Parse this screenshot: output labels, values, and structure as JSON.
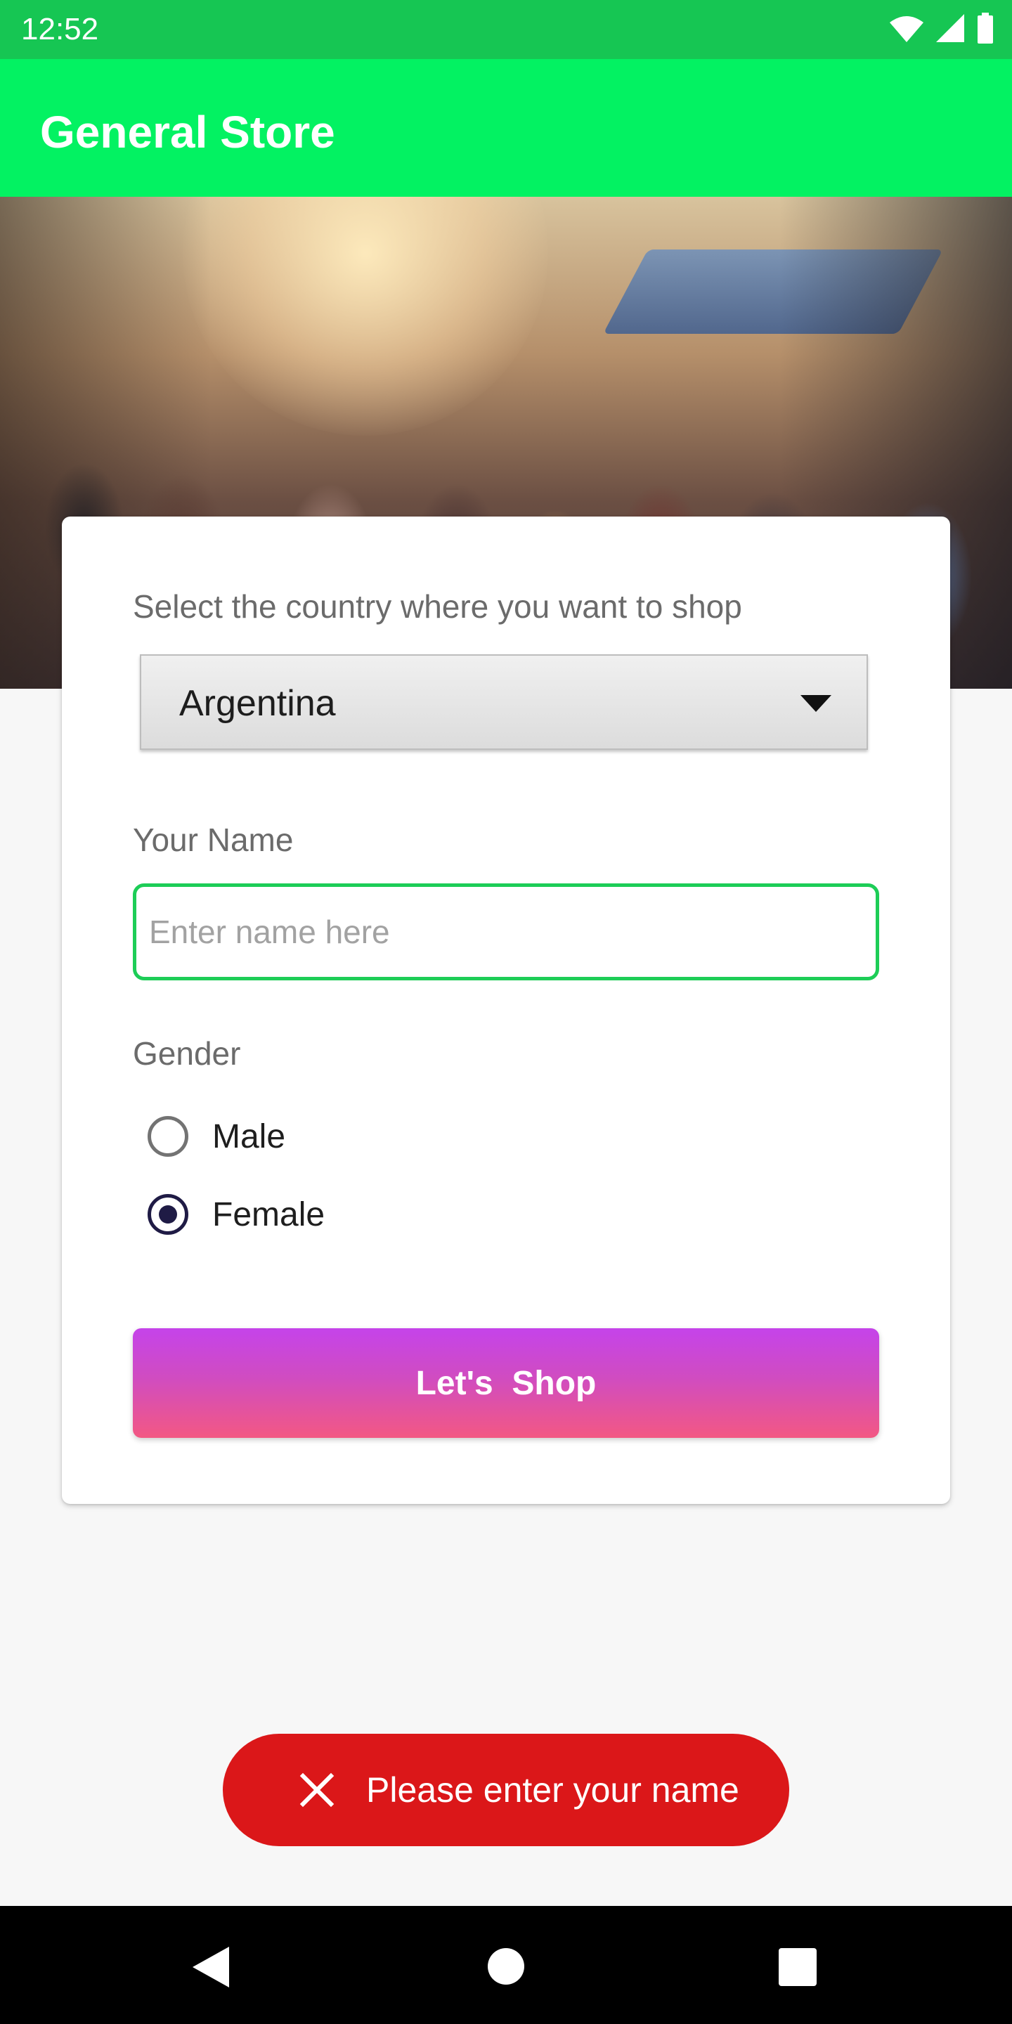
{
  "status_bar": {
    "time": "12:52",
    "icons": [
      "wifi-icon",
      "signal-icon",
      "battery-icon"
    ],
    "background": "#16c653"
  },
  "app_bar": {
    "title": "General Store",
    "background": "#03f262"
  },
  "hero_image": {
    "description_icon": "street-crowd-photo"
  },
  "form": {
    "country_label": "Select the country where you want to shop",
    "country_selected": "Argentina",
    "name_label": "Your Name",
    "name_value": "",
    "name_placeholder": "Enter name here",
    "gender_label": "Gender",
    "gender_options": [
      {
        "label": "Male",
        "selected": false
      },
      {
        "label": "Female",
        "selected": true
      }
    ],
    "submit_label": "Let's  Shop",
    "accent_color": "#1dcd57"
  },
  "toast": {
    "message": "Please enter your name",
    "icon": "close-icon",
    "background": "#db1719"
  },
  "nav_bar": {
    "buttons": [
      "back-icon",
      "home-icon",
      "recents-icon"
    ]
  }
}
